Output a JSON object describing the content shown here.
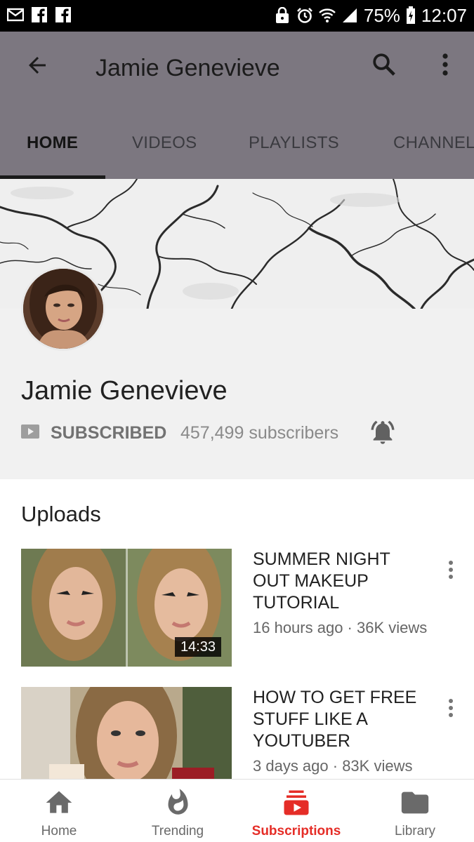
{
  "status_bar": {
    "battery": "75%",
    "time": "12:07",
    "icons": [
      "mail-icon",
      "facebook-icon",
      "facebook-icon",
      "lock-icon",
      "alarm-icon",
      "wifi-icon",
      "signal-icon",
      "battery-icon"
    ]
  },
  "app_bar": {
    "title": "Jamie Genevieve",
    "back_icon": "arrow-back-icon",
    "search_icon": "search-icon",
    "more_icon": "more-vert-icon",
    "color": "#7c7780"
  },
  "tabs": [
    {
      "label": "HOME",
      "active": true
    },
    {
      "label": "VIDEOS",
      "active": false
    },
    {
      "label": "PLAYLISTS",
      "active": false
    },
    {
      "label": "CHANNEL",
      "active": false
    }
  ],
  "channel": {
    "name": "Jamie Genevieve",
    "subscribed_label": "SUBSCRIBED",
    "subscriber_count": "457,499 subscribers",
    "bell_icon": "bell-ringing-icon"
  },
  "uploads": {
    "title": "Uploads",
    "videos": [
      {
        "title": "SUMMER NIGHT OUT MAKEUP TUTORIAL",
        "meta": "16 hours ago · 36K views",
        "duration": "14:33"
      },
      {
        "title": "HOW TO GET FREE STUFF LIKE A YOUTUBER",
        "meta": "3 days ago · 83K views",
        "duration": ""
      }
    ]
  },
  "bottom_nav": [
    {
      "label": "Home",
      "icon": "home-icon",
      "active": false
    },
    {
      "label": "Trending",
      "icon": "flame-icon",
      "active": false
    },
    {
      "label": "Subscriptions",
      "icon": "subscriptions-icon",
      "active": true
    },
    {
      "label": "Library",
      "icon": "folder-icon",
      "active": false
    }
  ],
  "colors": {
    "accent": "#e52d27",
    "app_bar": "#7c7780",
    "header_bg": "#f1f1f1"
  }
}
